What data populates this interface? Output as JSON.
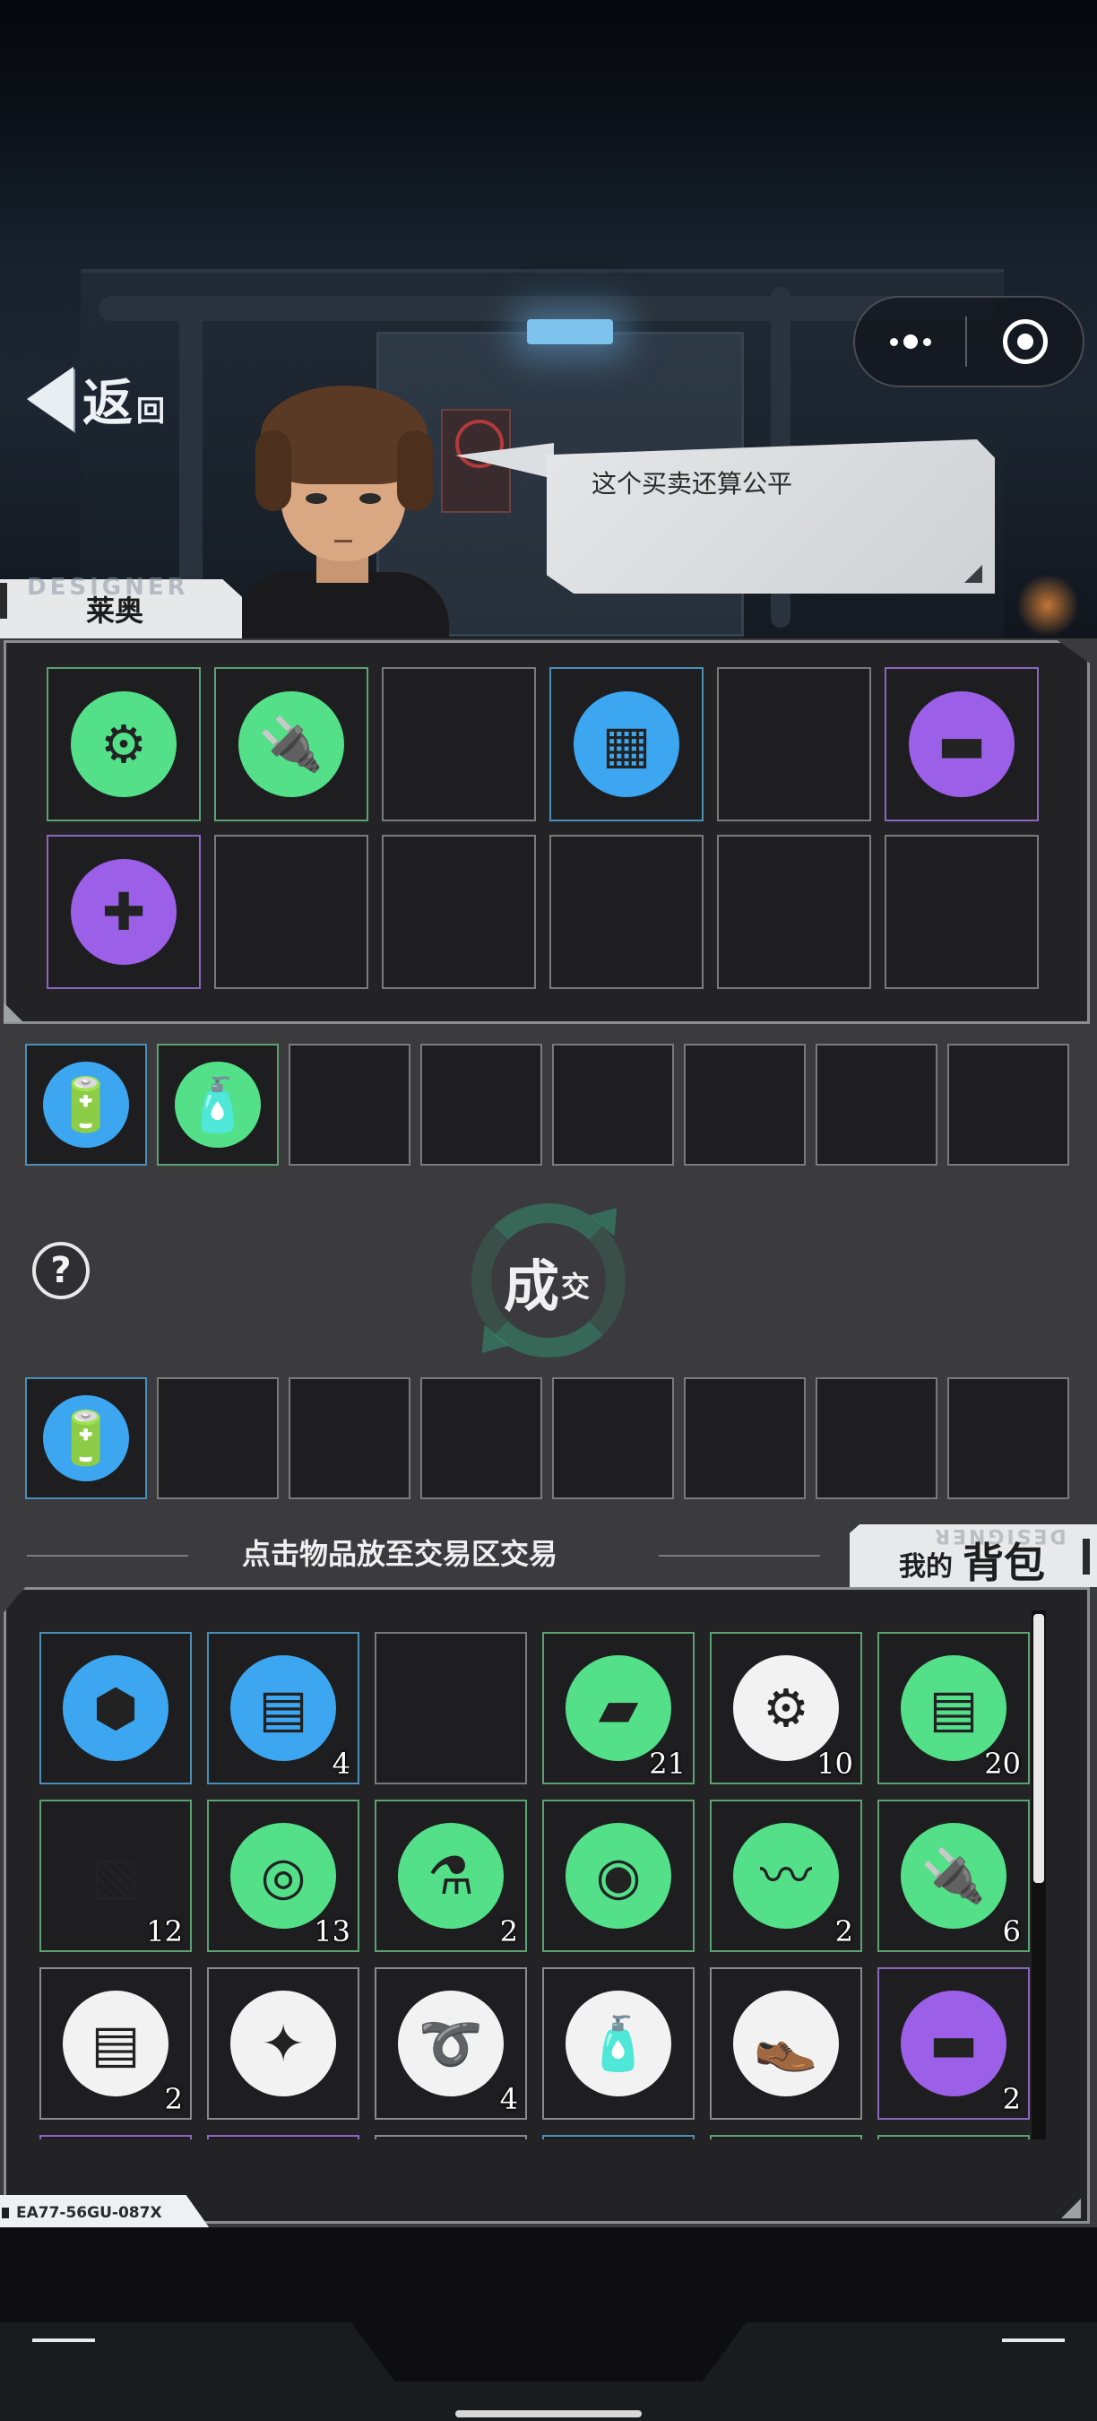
{
  "header": {
    "back_label_big": "返",
    "back_label_small": "回"
  },
  "npc": {
    "name": "莱奥",
    "name_watermark": "DESIGNER",
    "speech": "这个买卖还算公平"
  },
  "npc_inventory": {
    "slots": [
      {
        "icon": "gears-icon",
        "rarity": "green",
        "glyph": "⚙"
      },
      {
        "icon": "electronic-components-icon",
        "rarity": "green",
        "glyph": "🔌"
      },
      {
        "icon": "",
        "rarity": "empty",
        "glyph": ""
      },
      {
        "icon": "circuit-board-icon",
        "rarity": "blue",
        "glyph": "▦"
      },
      {
        "icon": "",
        "rarity": "empty",
        "glyph": ""
      },
      {
        "icon": "brick-blocks-icon",
        "rarity": "purple",
        "glyph": "▬"
      },
      {
        "icon": "medicine-bottle-icon",
        "rarity": "purple",
        "glyph": "✚"
      },
      {
        "icon": "",
        "rarity": "empty",
        "glyph": ""
      },
      {
        "icon": "",
        "rarity": "empty",
        "glyph": ""
      },
      {
        "icon": "",
        "rarity": "empty",
        "glyph": ""
      },
      {
        "icon": "",
        "rarity": "empty",
        "glyph": ""
      },
      {
        "icon": "",
        "rarity": "empty",
        "glyph": ""
      }
    ]
  },
  "npc_offer": {
    "slots": [
      {
        "icon": "battery-icon",
        "rarity": "blue",
        "glyph": "🔋"
      },
      {
        "icon": "water-bottle-icon",
        "rarity": "green",
        "glyph": "🧴"
      },
      {
        "icon": "",
        "rarity": "empty",
        "glyph": ""
      },
      {
        "icon": "",
        "rarity": "empty",
        "glyph": ""
      },
      {
        "icon": "",
        "rarity": "empty",
        "glyph": ""
      },
      {
        "icon": "",
        "rarity": "empty",
        "glyph": ""
      },
      {
        "icon": "",
        "rarity": "empty",
        "glyph": ""
      },
      {
        "icon": "",
        "rarity": "empty",
        "glyph": ""
      }
    ]
  },
  "trade": {
    "label_big": "成",
    "label_small": "交",
    "help_glyph": "?"
  },
  "player_offer": {
    "slots": [
      {
        "icon": "battery-icon",
        "rarity": "blue",
        "glyph": "🔋"
      },
      {
        "icon": "",
        "rarity": "empty",
        "glyph": ""
      },
      {
        "icon": "",
        "rarity": "empty",
        "glyph": ""
      },
      {
        "icon": "",
        "rarity": "empty",
        "glyph": ""
      },
      {
        "icon": "",
        "rarity": "empty",
        "glyph": ""
      },
      {
        "icon": "",
        "rarity": "empty",
        "glyph": ""
      },
      {
        "icon": "",
        "rarity": "empty",
        "glyph": ""
      },
      {
        "icon": "",
        "rarity": "empty",
        "glyph": ""
      }
    ]
  },
  "hint": "点击物品放至交易区交易",
  "bag": {
    "tab_label_small": "我的",
    "tab_label_big": "背包",
    "tab_watermark": "DESIGNER",
    "items": [
      {
        "icon": "coal-icon",
        "rarity": "blue",
        "disc": "blue",
        "glyph": "⬢",
        "qty": ""
      },
      {
        "icon": "wood-scraps-icon",
        "rarity": "blue",
        "disc": "blue",
        "glyph": "▤",
        "qty": "4"
      },
      {
        "icon": "",
        "rarity": "empty",
        "disc": "",
        "glyph": "",
        "qty": ""
      },
      {
        "icon": "metal-ingot-icon",
        "rarity": "green",
        "disc": "green",
        "glyph": "▰",
        "qty": "21"
      },
      {
        "icon": "gears-icon",
        "rarity": "green",
        "disc": "white",
        "glyph": "⚙",
        "qty": "10"
      },
      {
        "icon": "wood-planks-icon",
        "rarity": "green",
        "disc": "green",
        "glyph": "▤",
        "qty": "20"
      },
      {
        "icon": "cloth-icon",
        "rarity": "green",
        "disc": "",
        "glyph": "▧",
        "qty": "12"
      },
      {
        "icon": "tape-roll-icon",
        "rarity": "green",
        "disc": "green",
        "glyph": "◎",
        "qty": "13"
      },
      {
        "icon": "chemical-flask-icon",
        "rarity": "green",
        "disc": "green",
        "glyph": "⚗",
        "qty": "2"
      },
      {
        "icon": "holographic-disc-icon",
        "rarity": "green",
        "disc": "green",
        "glyph": "◉",
        "qty": ""
      },
      {
        "icon": "wires-icon",
        "rarity": "green",
        "disc": "green",
        "glyph": "〰",
        "qty": "2"
      },
      {
        "icon": "electronic-components-icon",
        "rarity": "green",
        "disc": "green",
        "glyph": "🔌",
        "qty": "6"
      },
      {
        "icon": "broken-wood-icon",
        "rarity": "white",
        "disc": "white",
        "glyph": "▤",
        "qty": "2"
      },
      {
        "icon": "rags-icon",
        "rarity": "white",
        "disc": "white",
        "glyph": "✦",
        "qty": ""
      },
      {
        "icon": "rope-icon",
        "rarity": "white",
        "disc": "white",
        "glyph": "➰",
        "qty": "4"
      },
      {
        "icon": "glue-bottle-icon",
        "rarity": "white",
        "disc": "white",
        "glyph": "🧴",
        "qty": ""
      },
      {
        "icon": "old-shoes-icon",
        "rarity": "white",
        "disc": "white",
        "glyph": "👞",
        "qty": ""
      },
      {
        "icon": "brick-blocks-icon",
        "rarity": "purple",
        "disc": "purple",
        "glyph": "▬",
        "qty": "2"
      },
      {
        "icon": "",
        "rarity": "purple",
        "disc": "",
        "glyph": "",
        "qty": ""
      },
      {
        "icon": "",
        "rarity": "purple",
        "disc": "",
        "glyph": "",
        "qty": ""
      },
      {
        "icon": "",
        "rarity": "white",
        "disc": "",
        "glyph": "",
        "qty": ""
      },
      {
        "icon": "",
        "rarity": "blue",
        "disc": "",
        "glyph": "",
        "qty": ""
      },
      {
        "icon": "",
        "rarity": "green",
        "disc": "",
        "glyph": "",
        "qty": ""
      },
      {
        "icon": "",
        "rarity": "green",
        "disc": "",
        "glyph": "",
        "qty": ""
      }
    ]
  },
  "serial": "EA77-56GU-087X",
  "colors": {
    "green": "#53e089",
    "blue": "#3ca6f0",
    "purple": "#9b5fe8",
    "white": "#f2f2f2"
  }
}
